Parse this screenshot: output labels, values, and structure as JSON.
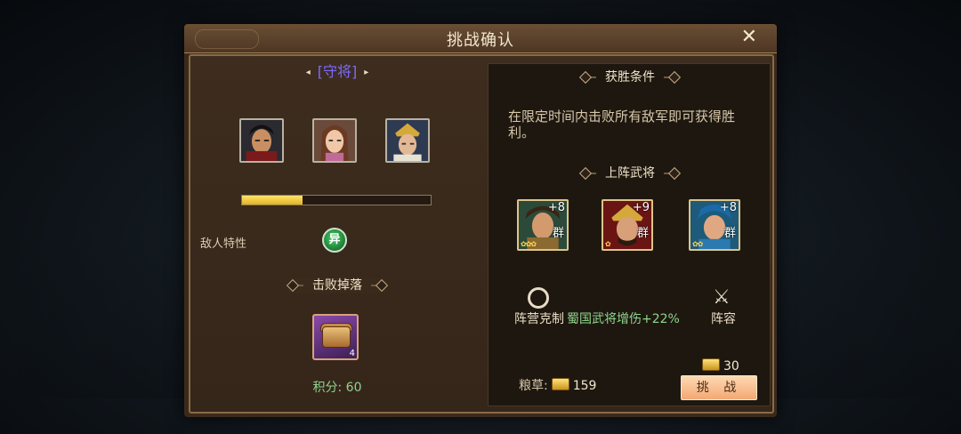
{
  "dialog": {
    "title": "挑战确认",
    "close_glyph": "✕"
  },
  "left": {
    "role_label": "[守将]",
    "arrow_left": "◂",
    "arrow_right": "▸",
    "enemy_progress": 0.32,
    "enemy_traits_label": "敌人特性",
    "trait_badge": "异",
    "drops_title": "击败掉落",
    "drop_item": {
      "count": "4"
    },
    "score_text": "积分: 60"
  },
  "right": {
    "win_title": "获胜条件",
    "win_text": "在限定时间内击败所有敌军即可获得胜利。",
    "lineup_title": "上阵武将",
    "generals": [
      {
        "plus": "+8",
        "faction": "群"
      },
      {
        "plus": "+9",
        "faction": "群"
      },
      {
        "plus": "+8",
        "faction": "群"
      }
    ],
    "camp_label": "阵营克制",
    "camp_bonus": "蜀国武将增伤+22%",
    "lineup_label": "阵容",
    "food_label": "粮草:",
    "food_value": "159",
    "cost_value": "30",
    "challenge_label": "挑 战"
  },
  "colors": {
    "role": "#7c6bff",
    "progress_fill": "#f0c433",
    "bonus_green": "#8fd48c",
    "challenge_button": "#f2a874"
  }
}
